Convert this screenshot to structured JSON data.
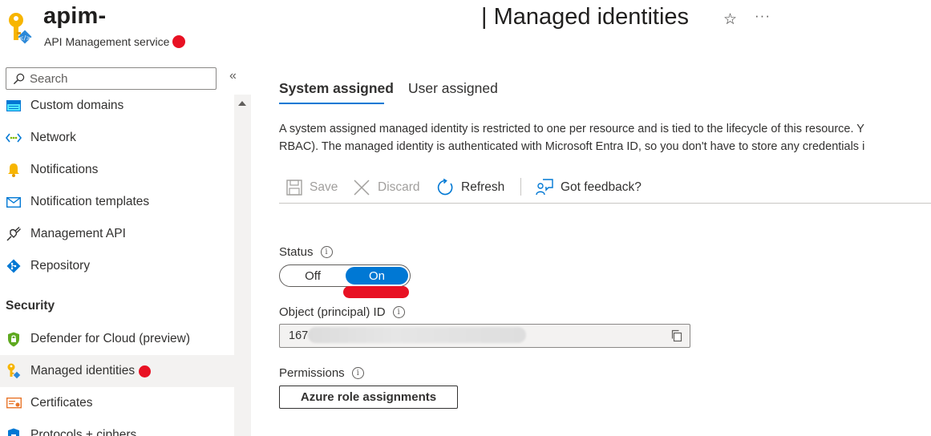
{
  "header": {
    "resource_name": "apim-",
    "resource_type": "API Management service",
    "page_title": "| Managed identities",
    "favorite_icon": "star-icon",
    "more_icon": "more-icon"
  },
  "sidebar": {
    "search_placeholder": "Search",
    "collapse_glyph": "«",
    "items": [
      {
        "label": "Custom domains",
        "icon": "custom-domains-icon"
      },
      {
        "label": "Network",
        "icon": "network-icon"
      },
      {
        "label": "Notifications",
        "icon": "bell-icon"
      },
      {
        "label": "Notification templates",
        "icon": "mail-icon"
      },
      {
        "label": "Management API",
        "icon": "plug-icon"
      },
      {
        "label": "Repository",
        "icon": "repository-icon"
      }
    ],
    "section_security": "Security",
    "security_items": [
      {
        "label": "Defender for Cloud (preview)",
        "icon": "shield-icon"
      },
      {
        "label": "Managed identities",
        "icon": "key-icon"
      },
      {
        "label": "Certificates",
        "icon": "certificate-icon"
      },
      {
        "label": "Protocols + ciphers",
        "icon": "shield-lock-icon"
      }
    ]
  },
  "tabs": [
    {
      "label": "System assigned",
      "active": true
    },
    {
      "label": "User assigned",
      "active": false
    }
  ],
  "description": {
    "line1": "A system assigned managed identity is restricted to one per resource and is tied to the lifecycle of this resource. Y",
    "line2": "RBAC). The managed identity is authenticated with Microsoft Entra ID, so you don't have to store any credentials i"
  },
  "toolbar": {
    "save": "Save",
    "discard": "Discard",
    "refresh": "Refresh",
    "feedback": "Got feedback?"
  },
  "status": {
    "label": "Status",
    "off": "Off",
    "on": "On",
    "value": "On"
  },
  "object_id": {
    "label": "Object (principal) ID",
    "value": "167"
  },
  "permissions": {
    "label": "Permissions",
    "button": "Azure role assignments"
  },
  "colors": {
    "accent": "#0078d4",
    "redaction": "#e81123",
    "selected_bg": "#f3f2f1"
  }
}
